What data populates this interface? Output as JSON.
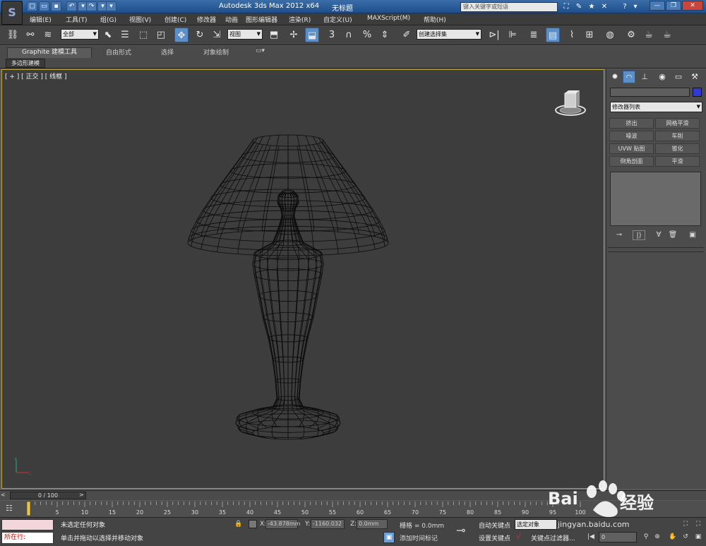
{
  "titlebar": {
    "app_title": "Autodesk 3ds Max  2012 x64",
    "doc_name": "无标题",
    "search_placeholder": "键入关键字或短语",
    "quick_access": [
      "new",
      "open",
      "save",
      "undo",
      "redo",
      "more"
    ],
    "icons": [
      "binoculars-icon",
      "tools-icon",
      "star-icon",
      "help-icon"
    ]
  },
  "menu": [
    "编辑(E)",
    "工具(T)",
    "组(G)",
    "视图(V)",
    "创建(C)",
    "修改器",
    "动画",
    "图形编辑器",
    "渲染(R)",
    "自定义(U)",
    "MAXScript(M)",
    "帮助(H)"
  ],
  "toolbar": {
    "selection_filter": "全部",
    "reference_coord": "视图",
    "named_selection": "创建选择集",
    "snap_label": "3",
    "percent_snap": "%"
  },
  "ribbon": {
    "tabs": [
      "Graphite 建模工具",
      "自由形式",
      "选择",
      "对象绘制"
    ],
    "panel_label": "多边形建模"
  },
  "viewport": {
    "label": "[ + ] [ 正交 ] [ 线框 ]",
    "shading": "线框",
    "view": "正交"
  },
  "command_panel": {
    "modifier_list": "修改器列表",
    "modifier_buttons": [
      "挤出",
      "网格平滑",
      "噪波",
      "车削",
      "UVW 贴图",
      "锥化",
      "倒角剖面",
      "平滑"
    ],
    "object_color": "#2f3bd4"
  },
  "timeslider": {
    "range": "0 / 100"
  },
  "trackbar": {
    "ticks": [
      0,
      5,
      10,
      15,
      20,
      25,
      30,
      35,
      40,
      45,
      50,
      55,
      60,
      65,
      70,
      75,
      80,
      85,
      90,
      95,
      100
    ]
  },
  "statusbar": {
    "maxscript_label": "所在行:",
    "status": "未选定任何对象",
    "prompt": "单击并拖动以选择并移动对象",
    "x_label": "X:",
    "x_value": "-43.878mm",
    "y_label": "Y:",
    "y_value": "-1160.032",
    "z_label": "Z:",
    "z_value": "0.0mm",
    "grid": "栅格 = 0.0mm",
    "add_time_tag": "添加时间标记",
    "auto_key": "自动关键点",
    "set_key": "设置关键点",
    "selected_set": "选定对象",
    "key_filters": "关键点过滤器...",
    "frame": "0"
  },
  "watermark": {
    "brand": "Bai",
    "brand2": "经验",
    "url": "jingyan.baidu.com"
  }
}
